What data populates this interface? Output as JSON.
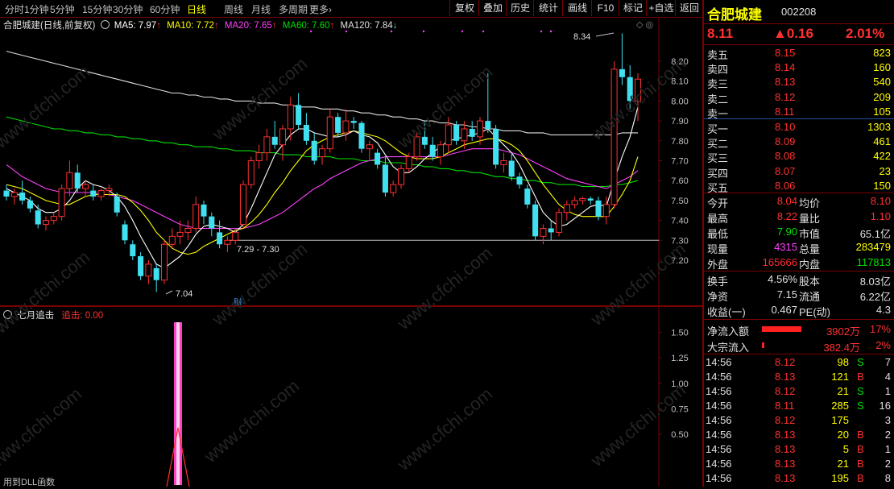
{
  "toolbar": {
    "periods": [
      "分时",
      "1分钟",
      "5分钟",
      "15分钟",
      "30分钟",
      "60分钟",
      "日线",
      "周线",
      "月线",
      "多周期",
      "更多›"
    ],
    "active_period": "日线",
    "buttons": [
      "复权",
      "叠加",
      "历史",
      "统计",
      "画线",
      "F10",
      "标记",
      "+自选",
      "返回"
    ]
  },
  "main_info": {
    "title": "合肥城建(日线,前复权)",
    "ma5": "MA5: 7.97",
    "ma10": "MA10: 7.72",
    "ma20": "MA20: 7.65",
    "ma60": "MA60: 7.60",
    "ma120": "MA120: 7.84"
  },
  "price_axis": [
    "8.20",
    "8.10",
    "8.00",
    "7.90",
    "7.80",
    "7.70",
    "7.60",
    "7.50",
    "7.40",
    "7.30",
    "7.20"
  ],
  "annotations": {
    "high_label": "8.34",
    "low_label": "7.04",
    "range_label": "7.29 - 7.30",
    "fin_marker": "财"
  },
  "sub_info": {
    "title": "七月追击",
    "indicator": "追击: 0.00",
    "footer": "用到DLL函数"
  },
  "sub_axis": [
    "1.50",
    "1.25",
    "1.00",
    "0.75",
    "0.50"
  ],
  "watermark": "www.cfchi.com",
  "colors": {
    "ma5": "#ffffff",
    "ma10": "#ffff00",
    "ma20": "#ff40ff",
    "ma60": "#00dd00",
    "ma120": "#e0e0e0",
    "up": "#ff3030",
    "down": "#40e0f0",
    "accent": "#ff3030"
  },
  "chart_data": {
    "type": "candlestick",
    "ylim": [
      7.0,
      8.35
    ],
    "candles": [
      [
        7.55,
        7.58,
        7.5,
        7.52
      ],
      [
        7.52,
        7.56,
        7.48,
        7.54
      ],
      [
        7.54,
        7.6,
        7.48,
        7.5
      ],
      [
        7.5,
        7.52,
        7.44,
        7.46
      ],
      [
        7.45,
        7.48,
        7.36,
        7.38
      ],
      [
        7.38,
        7.42,
        7.35,
        7.4
      ],
      [
        7.4,
        7.44,
        7.38,
        7.42
      ],
      [
        7.42,
        7.58,
        7.4,
        7.56
      ],
      [
        7.56,
        7.7,
        7.52,
        7.64
      ],
      [
        7.64,
        7.68,
        7.54,
        7.56
      ],
      [
        7.56,
        7.6,
        7.52,
        7.58
      ],
      [
        7.55,
        7.58,
        7.5,
        7.52
      ],
      [
        7.52,
        7.56,
        7.5,
        7.55
      ],
      [
        7.55,
        7.58,
        7.52,
        7.56
      ],
      [
        7.52,
        7.54,
        7.42,
        7.44
      ],
      [
        7.38,
        7.4,
        7.28,
        7.3
      ],
      [
        7.28,
        7.3,
        7.2,
        7.22
      ],
      [
        7.22,
        7.24,
        7.1,
        7.12
      ],
      [
        7.12,
        7.2,
        7.08,
        7.18
      ],
      [
        7.16,
        7.18,
        7.04,
        7.1
      ],
      [
        7.1,
        7.3,
        7.08,
        7.28
      ],
      [
        7.28,
        7.36,
        7.26,
        7.32
      ],
      [
        7.32,
        7.4,
        7.28,
        7.34
      ],
      [
        7.34,
        7.4,
        7.3,
        7.36
      ],
      [
        7.36,
        7.52,
        7.34,
        7.48
      ],
      [
        7.48,
        7.5,
        7.38,
        7.42
      ],
      [
        7.42,
        7.44,
        7.32,
        7.36
      ],
      [
        7.34,
        7.4,
        7.26,
        7.28
      ],
      [
        7.28,
        7.32,
        7.24,
        7.3
      ],
      [
        7.3,
        7.36,
        7.28,
        7.34
      ],
      [
        7.38,
        7.6,
        7.36,
        7.58
      ],
      [
        7.58,
        7.72,
        7.56,
        7.7
      ],
      [
        7.7,
        7.78,
        7.66,
        7.74
      ],
      [
        7.74,
        7.86,
        7.7,
        7.82
      ],
      [
        7.82,
        7.9,
        7.76,
        7.78
      ],
      [
        7.78,
        7.88,
        7.7,
        7.86
      ],
      [
        7.86,
        8.02,
        7.8,
        7.98
      ],
      [
        7.98,
        8.04,
        7.86,
        7.88
      ],
      [
        7.88,
        7.94,
        7.78,
        7.8
      ],
      [
        7.8,
        7.84,
        7.68,
        7.7
      ],
      [
        7.72,
        7.78,
        7.68,
        7.76
      ],
      [
        7.76,
        7.96,
        7.74,
        7.92
      ],
      [
        7.92,
        7.94,
        7.82,
        7.84
      ],
      [
        7.84,
        7.96,
        7.8,
        7.9
      ],
      [
        7.9,
        7.92,
        7.86,
        7.89
      ],
      [
        7.89,
        7.9,
        7.74,
        7.76
      ],
      [
        7.76,
        7.8,
        7.7,
        7.78
      ],
      [
        7.74,
        7.76,
        7.66,
        7.68
      ],
      [
        7.68,
        7.72,
        7.52,
        7.54
      ],
      [
        7.54,
        7.6,
        7.52,
        7.58
      ],
      [
        7.58,
        7.68,
        7.56,
        7.66
      ],
      [
        7.66,
        7.74,
        7.64,
        7.72
      ],
      [
        7.72,
        7.84,
        7.7,
        7.82
      ],
      [
        7.82,
        7.9,
        7.76,
        7.78
      ],
      [
        7.78,
        7.82,
        7.7,
        7.72
      ],
      [
        7.72,
        7.8,
        7.68,
        7.78
      ],
      [
        7.78,
        7.92,
        7.74,
        7.88
      ],
      [
        7.88,
        7.9,
        7.78,
        7.8
      ],
      [
        7.8,
        7.9,
        7.76,
        7.86
      ],
      [
        7.86,
        7.9,
        7.8,
        7.82
      ],
      [
        7.82,
        7.92,
        7.78,
        7.9
      ],
      [
        7.9,
        8.14,
        7.84,
        7.86
      ],
      [
        7.86,
        7.88,
        7.66,
        7.68
      ],
      [
        7.68,
        7.74,
        7.64,
        7.7
      ],
      [
        7.7,
        7.74,
        7.6,
        7.62
      ],
      [
        7.62,
        7.64,
        7.56,
        7.58
      ],
      [
        7.56,
        7.58,
        7.46,
        7.48
      ],
      [
        7.48,
        7.5,
        7.3,
        7.32
      ],
      [
        7.32,
        7.38,
        7.28,
        7.36
      ],
      [
        7.36,
        7.4,
        7.3,
        7.34
      ],
      [
        7.34,
        7.46,
        7.32,
        7.44
      ],
      [
        7.44,
        7.5,
        7.4,
        7.48
      ],
      [
        7.48,
        7.52,
        7.46,
        7.5
      ],
      [
        7.5,
        7.52,
        7.48,
        7.51
      ],
      [
        7.51,
        7.52,
        7.48,
        7.5
      ],
      [
        7.5,
        7.52,
        7.4,
        7.42
      ],
      [
        7.42,
        7.52,
        7.38,
        7.48
      ],
      [
        7.48,
        8.2,
        7.46,
        8.16
      ],
      [
        8.16,
        8.34,
        8.08,
        8.12
      ],
      [
        8.12,
        8.18,
        7.96,
        8.0
      ],
      [
        8.0,
        8.14,
        7.9,
        8.11
      ]
    ],
    "ma5": [
      7.56,
      7.54,
      7.52,
      7.5,
      7.46,
      7.44,
      7.44,
      7.46,
      7.5,
      7.56,
      7.6,
      7.58,
      7.57,
      7.55,
      7.52,
      7.47,
      7.4,
      7.32,
      7.25,
      7.18,
      7.16,
      7.19,
      7.22,
      7.27,
      7.33,
      7.37,
      7.38,
      7.37,
      7.36,
      7.34,
      7.38,
      7.46,
      7.55,
      7.64,
      7.73,
      7.78,
      7.83,
      7.86,
      7.86,
      7.84,
      7.83,
      7.82,
      7.82,
      7.83,
      7.85,
      7.83,
      7.82,
      7.79,
      7.73,
      7.67,
      7.64,
      7.64,
      7.67,
      7.71,
      7.74,
      7.77,
      7.8,
      7.81,
      7.82,
      7.83,
      7.84,
      7.86,
      7.82,
      7.78,
      7.74,
      7.68,
      7.6,
      7.52,
      7.44,
      7.4,
      7.37,
      7.38,
      7.41,
      7.44,
      7.47,
      7.48,
      7.47,
      7.6,
      7.72,
      7.82,
      7.97
    ],
    "ma10": [
      7.58,
      7.57,
      7.56,
      7.54,
      7.52,
      7.5,
      7.49,
      7.48,
      7.48,
      7.5,
      7.52,
      7.53,
      7.53,
      7.53,
      7.53,
      7.52,
      7.49,
      7.45,
      7.4,
      7.34,
      7.3,
      7.26,
      7.24,
      7.23,
      7.24,
      7.27,
      7.29,
      7.31,
      7.33,
      7.35,
      7.36,
      7.39,
      7.43,
      7.48,
      7.54,
      7.59,
      7.65,
      7.7,
      7.75,
      7.78,
      7.8,
      7.82,
      7.83,
      7.84,
      7.85,
      7.84,
      7.83,
      7.82,
      7.8,
      7.77,
      7.74,
      7.72,
      7.71,
      7.71,
      7.71,
      7.72,
      7.74,
      7.76,
      7.78,
      7.79,
      7.8,
      7.81,
      7.81,
      7.8,
      7.78,
      7.75,
      7.7,
      7.64,
      7.58,
      7.53,
      7.48,
      7.45,
      7.43,
      7.42,
      7.42,
      7.42,
      7.42,
      7.47,
      7.53,
      7.6,
      7.72
    ],
    "ma20": [
      7.68,
      7.65,
      7.62,
      7.6,
      7.58,
      7.56,
      7.55,
      7.54,
      7.54,
      7.54,
      7.54,
      7.54,
      7.53,
      7.53,
      7.52,
      7.51,
      7.5,
      7.48,
      7.46,
      7.44,
      7.42,
      7.4,
      7.38,
      7.37,
      7.36,
      7.36,
      7.36,
      7.36,
      7.36,
      7.36,
      7.36,
      7.37,
      7.38,
      7.4,
      7.42,
      7.44,
      7.47,
      7.5,
      7.53,
      7.56,
      7.58,
      7.61,
      7.63,
      7.65,
      7.67,
      7.69,
      7.7,
      7.71,
      7.72,
      7.72,
      7.72,
      7.72,
      7.72,
      7.72,
      7.72,
      7.72,
      7.73,
      7.74,
      7.75,
      7.76,
      7.76,
      7.76,
      7.76,
      7.75,
      7.74,
      7.73,
      7.71,
      7.69,
      7.67,
      7.65,
      7.63,
      7.61,
      7.6,
      7.59,
      7.58,
      7.57,
      7.56,
      7.58,
      7.6,
      7.62,
      7.65
    ],
    "ma60": [
      7.92,
      7.91,
      7.9,
      7.89,
      7.88,
      7.87,
      7.86,
      7.86,
      7.85,
      7.85,
      7.84,
      7.84,
      7.83,
      7.83,
      7.82,
      7.82,
      7.81,
      7.81,
      7.8,
      7.8,
      7.79,
      7.79,
      7.78,
      7.78,
      7.77,
      7.77,
      7.77,
      7.76,
      7.76,
      7.75,
      7.75,
      7.75,
      7.74,
      7.74,
      7.74,
      7.73,
      7.73,
      7.73,
      7.72,
      7.72,
      7.72,
      7.72,
      7.71,
      7.71,
      7.71,
      7.7,
      7.7,
      7.7,
      7.69,
      7.69,
      7.69,
      7.68,
      7.68,
      7.67,
      7.67,
      7.66,
      7.66,
      7.65,
      7.65,
      7.64,
      7.64,
      7.63,
      7.62,
      7.62,
      7.61,
      7.61,
      7.6,
      7.6,
      7.59,
      7.59,
      7.58,
      7.58,
      7.58,
      7.57,
      7.57,
      7.57,
      7.57,
      7.58,
      7.58,
      7.59,
      7.6
    ],
    "ma120": [
      8.25,
      8.24,
      8.23,
      8.22,
      8.21,
      8.2,
      8.19,
      8.18,
      8.17,
      8.16,
      8.15,
      8.14,
      8.13,
      8.12,
      8.11,
      8.1,
      8.09,
      8.08,
      8.07,
      8.06,
      8.05,
      8.04,
      8.04,
      8.03,
      8.03,
      8.02,
      8.02,
      8.01,
      8.01,
      8.0,
      8.0,
      8.0,
      7.99,
      7.99,
      7.99,
      7.98,
      7.98,
      7.97,
      7.97,
      7.97,
      7.96,
      7.96,
      7.96,
      7.95,
      7.95,
      7.94,
      7.94,
      7.93,
      7.93,
      7.92,
      7.92,
      7.91,
      7.91,
      7.9,
      7.9,
      7.89,
      7.89,
      7.88,
      7.88,
      7.87,
      7.87,
      7.86,
      7.86,
      7.85,
      7.85,
      7.85,
      7.84,
      7.84,
      7.84,
      7.83,
      7.83,
      7.83,
      7.83,
      7.83,
      7.83,
      7.83,
      7.83,
      7.83,
      7.84,
      7.84,
      7.84
    ],
    "zhuiji": {
      "ylim": [
        0,
        1.6
      ],
      "spike_index": 26,
      "spike_value": 1.6
    }
  },
  "quote": {
    "name": "合肥城建",
    "code": "002208",
    "price": "8.11",
    "change": "▲0.16",
    "pct": "2.01%",
    "asks": [
      {
        "label": "卖五",
        "price": "8.15",
        "vol": "823"
      },
      {
        "label": "卖四",
        "price": "8.14",
        "vol": "160"
      },
      {
        "label": "卖三",
        "price": "8.13",
        "vol": "540"
      },
      {
        "label": "卖二",
        "price": "8.12",
        "vol": "209"
      },
      {
        "label": "卖一",
        "price": "8.11",
        "vol": "105"
      }
    ],
    "bids": [
      {
        "label": "买一",
        "price": "8.10",
        "vol": "1303"
      },
      {
        "label": "买二",
        "price": "8.09",
        "vol": "461"
      },
      {
        "label": "买三",
        "price": "8.08",
        "vol": "422"
      },
      {
        "label": "买四",
        "price": "8.07",
        "vol": "23"
      },
      {
        "label": "买五",
        "price": "8.06",
        "vol": "150"
      }
    ],
    "stats": [
      {
        "l1": "今开",
        "v1": "8.04",
        "l2": "均价",
        "v2": "8.10"
      },
      {
        "l1": "最高",
        "v1": "8.22",
        "l2": "量比",
        "v2": "1.10"
      },
      {
        "l1": "最低",
        "v1": "7.90",
        "l2": "市值",
        "v2": "65.1亿"
      },
      {
        "l1": "现量",
        "v1": "4315",
        "l2": "总量",
        "v2": "283479"
      },
      {
        "l1": "外盘",
        "v1": "165666",
        "l2": "内盘",
        "v2": "117813"
      }
    ],
    "fund": [
      {
        "l1": "换手",
        "v1": "4.56%",
        "l2": "股本",
        "v2": "8.03亿"
      },
      {
        "l1": "净资",
        "v1": "7.15",
        "l2": "流通",
        "v2": "6.22亿"
      },
      {
        "l1": "收益(一)",
        "v1": "0.467",
        "l2": "PE(动)",
        "v2": "4.3"
      }
    ],
    "flow": [
      {
        "label": "净流入额",
        "value": "3902万",
        "pct": "17%",
        "bar": 0.9
      },
      {
        "label": "大宗流入",
        "value": "382.4万",
        "pct": "2%",
        "bar": 0.05
      }
    ],
    "ticks": [
      {
        "t": "14:56",
        "p": "8.12",
        "v": "98",
        "bs": "S",
        "n": "7"
      },
      {
        "t": "14:56",
        "p": "8.13",
        "v": "121",
        "bs": "B",
        "n": "4"
      },
      {
        "t": "14:56",
        "p": "8.12",
        "v": "21",
        "bs": "S",
        "n": "1"
      },
      {
        "t": "14:56",
        "p": "8.11",
        "v": "285",
        "bs": "S",
        "n": "16"
      },
      {
        "t": "14:56",
        "p": "8.12",
        "v": "175",
        "bs": "",
        "n": "3"
      },
      {
        "t": "14:56",
        "p": "8.13",
        "v": "20",
        "bs": "B",
        "n": "2"
      },
      {
        "t": "14:56",
        "p": "8.13",
        "v": "5",
        "bs": "B",
        "n": "1"
      },
      {
        "t": "14:56",
        "p": "8.13",
        "v": "21",
        "bs": "B",
        "n": "2"
      },
      {
        "t": "14:56",
        "p": "8.13",
        "v": "195",
        "bs": "B",
        "n": "8"
      }
    ]
  }
}
